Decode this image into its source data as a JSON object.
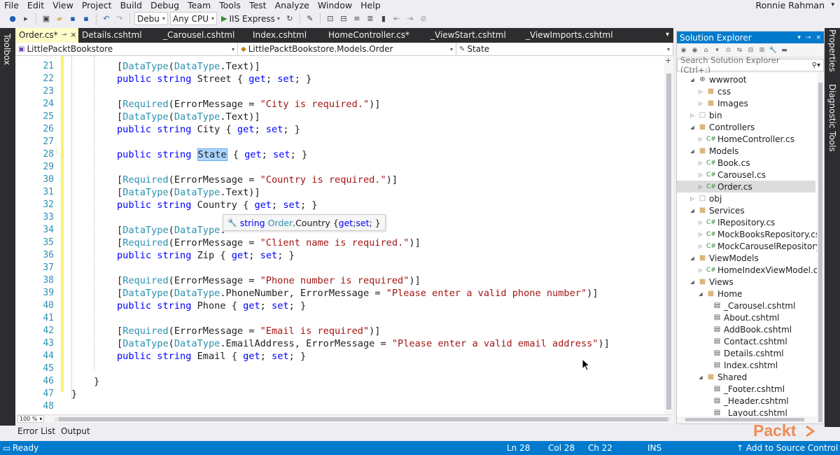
{
  "menubar": {
    "items": [
      "File",
      "Edit",
      "View",
      "Project",
      "Build",
      "Debug",
      "Team",
      "Tools",
      "Test",
      "Analyze",
      "Window",
      "Help"
    ],
    "user": "Ronnie Rahman"
  },
  "toolbar": {
    "config": "Debu",
    "platform": "Any CPU",
    "run_target": "IIS Express"
  },
  "left_tab": {
    "label": "Toolbox"
  },
  "right_tabs": {
    "properties": "Properties",
    "diagnostic": "Diagnostic Tools"
  },
  "doc_tabs": [
    {
      "label": "Order.cs*",
      "active": true
    },
    {
      "label": "Details.cshtml"
    },
    {
      "label": "_Carousel.cshtml"
    },
    {
      "label": "Index.cshtml"
    },
    {
      "label": "HomeController.cs*"
    },
    {
      "label": "_ViewStart.cshtml"
    },
    {
      "label": "_ViewImports.cshtml"
    }
  ],
  "navbar": {
    "project": "LittlePacktBookstore",
    "type": "LittlePacktBookstore.Models.Order",
    "member": "State"
  },
  "editor": {
    "line_numbers": [
      "21",
      "22",
      "23",
      "24",
      "25",
      "26",
      "27",
      "28",
      "29",
      "30",
      "31",
      "32",
      "33",
      "34",
      "35",
      "36",
      "37",
      "38",
      "39",
      "40",
      "41",
      "42",
      "43",
      "44",
      "45",
      "46",
      "47",
      "48"
    ],
    "zoom": "100 %"
  },
  "code": {
    "l21a": "[",
    "l21b": "DataType",
    "l21c": "(",
    "l21d": "DataType",
    "l21e": ".Text)]",
    "l22a": "public",
    "l22b": " ",
    "l22c": "string",
    "l22d": " Street { ",
    "l22e": "get",
    "l22f": "; ",
    "l22g": "set",
    "l22h": "; }",
    "l24a": "[",
    "l24b": "Required",
    "l24c": "(ErrorMessage = ",
    "l24d": "\"City is required.\"",
    "l24e": ")]",
    "l25a": "[",
    "l25b": "DataType",
    "l25c": "(",
    "l25d": "DataType",
    "l25e": ".Text)]",
    "l26a": "public",
    "l26b": " ",
    "l26c": "string",
    "l26d": " City { ",
    "l26e": "get",
    "l26f": "; ",
    "l26g": "set",
    "l26h": "; }",
    "l28a": "public",
    "l28b": " ",
    "l28c": "string",
    "l28d": " ",
    "l28sel": "State",
    "l28e": " { ",
    "l28f": "get",
    "l28g": "; ",
    "l28h": "set",
    "l28i": "; }",
    "l30a": "[",
    "l30b": "Required",
    "l30c": "(ErrorMessage = ",
    "l30d": "\"Country is required.\"",
    "l30e": ")]",
    "l31a": "[",
    "l31b": "DataType",
    "l31c": "(",
    "l31d": "DataType",
    "l31e": ".Text)]",
    "l32a": "public",
    "l32b": " ",
    "l32c": "string",
    "l32d": " Country { ",
    "l32e": "get",
    "l32f": "; ",
    "l32g": "set",
    "l32h": "; }",
    "l34a": "[",
    "l34b": "DataType",
    "l34c": "(",
    "l34d": "DataType",
    "l34e": ".",
    "l35a": "[",
    "l35b": "Required",
    "l35c": "(ErrorMessage = ",
    "l35d": "\"Client name is required.\"",
    "l35e": ")]",
    "l36a": "public",
    "l36b": " ",
    "l36c": "string",
    "l36d": " Zip { ",
    "l36e": "get",
    "l36f": "; ",
    "l36g": "set",
    "l36h": "; }",
    "l38a": "[",
    "l38b": "Required",
    "l38c": "(ErrorMessage = ",
    "l38d": "\"Phone number is required\"",
    "l38e": ")]",
    "l39a": "[",
    "l39b": "DataType",
    "l39c": "(",
    "l39d": "DataType",
    "l39e": ".PhoneNumber, ErrorMessage = ",
    "l39f": "\"Please enter a valid phone number\"",
    "l39g": ")]",
    "l40a": "public",
    "l40b": " ",
    "l40c": "string",
    "l40d": " Phone { ",
    "l40e": "get",
    "l40f": "; ",
    "l40g": "set",
    "l40h": "; }",
    "l42a": "[",
    "l42b": "Required",
    "l42c": "(ErrorMessage = ",
    "l42d": "\"Email is required\"",
    "l42e": ")]",
    "l43a": "[",
    "l43b": "DataType",
    "l43c": "(",
    "l43d": "DataType",
    "l43e": ".EmailAddress, ErrorMessage = ",
    "l43f": "\"Please enter a valid email address\"",
    "l43g": ")]",
    "l44a": "public",
    "l44b": " ",
    "l44c": "string",
    "l44d": " Email { ",
    "l44e": "get",
    "l44f": "; ",
    "l44g": "set",
    "l44h": "; }",
    "l46": "}",
    "l47": "}"
  },
  "quickinfo": {
    "kw": "string",
    "type": "Order",
    "member": ".Country { ",
    "get": "get",
    "sep": "; ",
    "set": "set",
    "end": "; }"
  },
  "bottom_tabs": [
    "Error List",
    "Output"
  ],
  "solution_explorer": {
    "title": "Solution Explorer",
    "search_placeholder": "Search Solution Explorer (Ctrl+;)",
    "items": [
      {
        "label": "wwwroot",
        "icon": "globe-icon",
        "exp": "open"
      },
      {
        "label": "css",
        "icon": "folder-icon",
        "exp": "closed"
      },
      {
        "label": "Images",
        "icon": "folder-icon",
        "exp": "closed"
      },
      {
        "label": "bin",
        "icon": "box-icon",
        "exp": "closed"
      },
      {
        "label": "Controllers",
        "icon": "folder-icon",
        "exp": "open"
      },
      {
        "label": "HomeController.cs",
        "icon": "cs-file-icon",
        "exp": "closed"
      },
      {
        "label": "Models",
        "icon": "folder-icon",
        "exp": "open"
      },
      {
        "label": "Book.cs",
        "icon": "cs-file-icon",
        "exp": "closed"
      },
      {
        "label": "Carousel.cs",
        "icon": "cs-file-icon",
        "exp": "closed"
      },
      {
        "label": "Order.cs",
        "icon": "cs-file-icon",
        "exp": "closed",
        "selected": true
      },
      {
        "label": "obj",
        "icon": "box-icon",
        "exp": "closed"
      },
      {
        "label": "Services",
        "icon": "folder-icon",
        "exp": "open"
      },
      {
        "label": "IRepository.cs",
        "icon": "cs-file-icon",
        "exp": "closed"
      },
      {
        "label": "MockBooksRepository.cs",
        "icon": "cs-file-icon",
        "exp": "closed"
      },
      {
        "label": "MockCarouselRepository.cs",
        "icon": "cs-file-icon",
        "exp": "closed"
      },
      {
        "label": "ViewModels",
        "icon": "folder-icon",
        "exp": "open"
      },
      {
        "label": "HomeIndexViewModel.cs",
        "icon": "cs-file-icon",
        "exp": "closed"
      },
      {
        "label": "Views",
        "icon": "folder-icon",
        "exp": "open"
      },
      {
        "label": "Home",
        "icon": "folder-icon",
        "exp": "open"
      },
      {
        "label": "_Carousel.cshtml",
        "icon": "page-icon"
      },
      {
        "label": "About.cshtml",
        "icon": "page-icon"
      },
      {
        "label": "AddBook.cshtml",
        "icon": "page-icon"
      },
      {
        "label": "Contact.cshtml",
        "icon": "page-icon"
      },
      {
        "label": "Details.cshtml",
        "icon": "page-icon"
      },
      {
        "label": "Index.cshtml",
        "icon": "page-icon"
      },
      {
        "label": "Shared",
        "icon": "folder-icon",
        "exp": "open"
      },
      {
        "label": "_Footer.cshtml",
        "icon": "page-icon"
      },
      {
        "label": "_Header.cshtml",
        "icon": "page-icon"
      },
      {
        "label": "_Layout.cshtml",
        "icon": "page-icon"
      }
    ]
  },
  "statusbar": {
    "ready": "Ready",
    "ln": "Ln 28",
    "col": "Col 28",
    "ch": "Ch 22",
    "ins": "INS",
    "source_control": "↑ Add to Source Control ▴"
  },
  "watermark": {
    "brand": "Packt"
  },
  "colors": {
    "accent": "#007acc",
    "keyword": "#0000ff",
    "type": "#2b91af",
    "string": "#a31515",
    "active_tab": "#fefcc8",
    "brand": "#f07a3a"
  }
}
